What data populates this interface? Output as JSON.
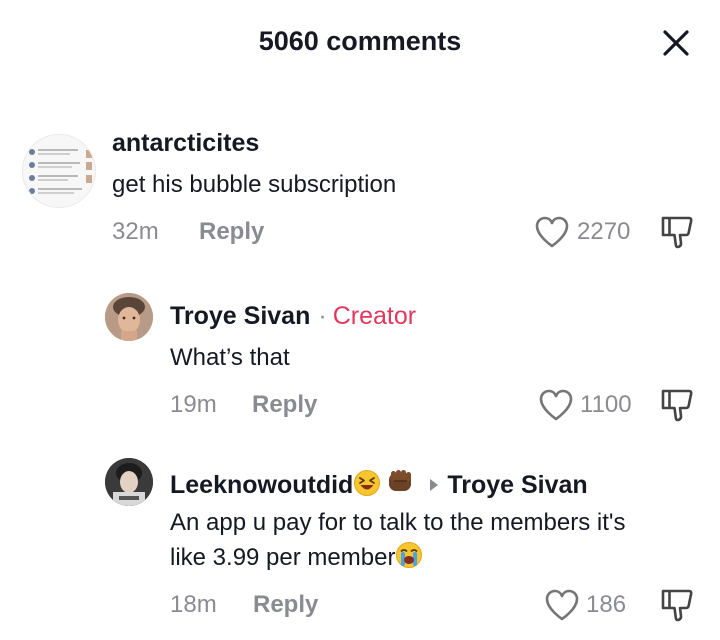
{
  "header": {
    "title": "5060 comments"
  },
  "comments": [
    {
      "username": "antarcticites",
      "text": "get his bubble subscription",
      "time": "32m",
      "reply_label": "Reply",
      "likes": "2270"
    },
    {
      "username": "Troye Sivan",
      "creator_label": "Creator",
      "text": "What’s that",
      "time": "19m",
      "reply_label": "Reply",
      "likes": "1100"
    },
    {
      "username": "Leeknowoutdid",
      "reply_to": "Troye Sivan",
      "text_line1": "An app u pay for to talk to the members it's",
      "text_line2": "like 3.99 per member",
      "time": "18m",
      "reply_label": "Reply",
      "likes": "186"
    }
  ],
  "colors": {
    "text": "#161823",
    "secondary": "#8a8b91",
    "creator": "#e0385e"
  },
  "icons": [
    "close-icon",
    "heart-icon",
    "dislike-icon",
    "caret-right-icon",
    "laughing-emoji-icon",
    "fist-emoji-icon",
    "crying-emoji-icon"
  ]
}
